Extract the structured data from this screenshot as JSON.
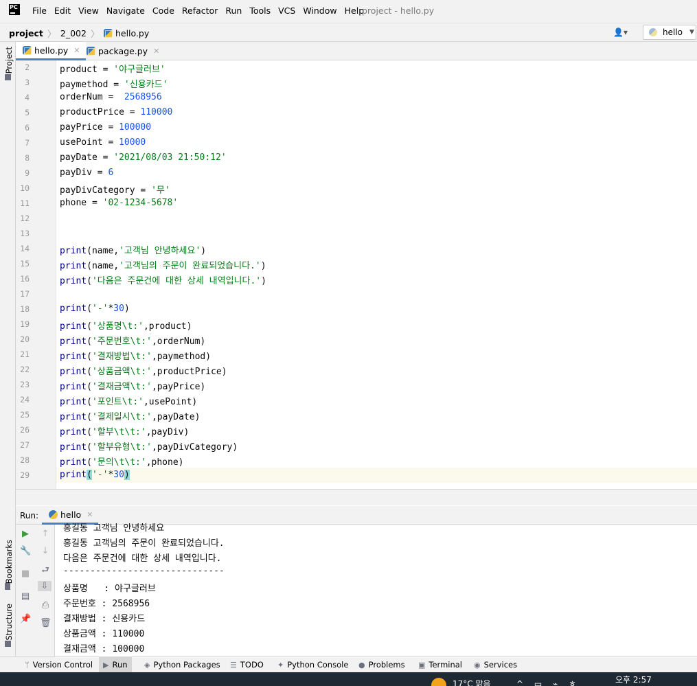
{
  "menubar": {
    "logo": "PC",
    "items": [
      "File",
      "Edit",
      "View",
      "Navigate",
      "Code",
      "Refactor",
      "Run",
      "Tools",
      "VCS",
      "Window",
      "Help"
    ],
    "window_title": "project - hello.py"
  },
  "breadcrumb": {
    "project": "project",
    "folder": "2_002",
    "file": "hello.py",
    "run_config": "hello"
  },
  "sidebar": {
    "project": "Project",
    "bookmarks": "Bookmarks",
    "structure": "Structure"
  },
  "tabs": [
    {
      "label": "hello.py"
    },
    {
      "label": "package.py"
    }
  ],
  "editor": {
    "line_numbers": [
      "2",
      "3",
      "4",
      "5",
      "6",
      "7",
      "8",
      "9",
      "10",
      "11",
      "12",
      "13",
      "14",
      "15",
      "16",
      "17",
      "18",
      "19",
      "20",
      "21",
      "22",
      "23",
      "24",
      "25",
      "26",
      "27",
      "28",
      "29"
    ],
    "lines": [
      "product = '야구글러브'",
      "paymethod = '신용카드'",
      "orderNum =  2568956",
      "productPrice = 110000",
      "payPrice = 100000",
      "usePoint = 10000",
      "payDate = '2021/08/03 21:50:12'",
      "payDiv = 6",
      "payDivCategory = '무'",
      "phone = '02-1234-5678'",
      "",
      "",
      "print(name,'고객님 안녕하세요')",
      "print(name,'고객님의 주문이 완료되었습니다.')",
      "print('다음은 주문건에 대한 상세 내역입니다.')",
      "",
      "print('-'*30)",
      "print('상품명\\t:',product)",
      "print('주문번호\\t:',orderNum)",
      "print('결재방법\\t:',paymethod)",
      "print('상품금액\\t:',productPrice)",
      "print('결재금액\\t:',payPrice)",
      "print('포인트\\t:',usePoint)",
      "print('결제일시\\t:',payDate)",
      "print('할부\\t\\t:',payDiv)",
      "print('할부유형\\t:',payDivCategory)",
      "print('문의\\t\\t:',phone)",
      "print('-'*30)"
    ]
  },
  "run_panel": {
    "label": "Run:",
    "tab": "hello",
    "output": [
      "홍길동 고객님 안녕하세요",
      "홍길동 고객님의 주문이 완료되었습니다.",
      "다음은 주문건에 대한 상세 내역입니다.",
      "------------------------------",
      "상품명   : 야구글러브",
      "주문번호 : 2568956",
      "결재방법 : 신용카드",
      "상품금액 : 110000",
      "결재금액 : 100000"
    ]
  },
  "tool_windows": [
    {
      "label": "Version Control",
      "icon": "version-control-icon"
    },
    {
      "label": "Run",
      "icon": "run-icon"
    },
    {
      "label": "Python Packages",
      "icon": "packages-icon"
    },
    {
      "label": "TODO",
      "icon": "todo-icon"
    },
    {
      "label": "Python Console",
      "icon": "python-console-icon"
    },
    {
      "label": "Problems",
      "icon": "problems-icon"
    },
    {
      "label": "Terminal",
      "icon": "terminal-icon"
    },
    {
      "label": "Services",
      "icon": "services-icon"
    }
  ],
  "taskbar": {
    "weather": "17°C  맑음",
    "clock": "오후 2:57"
  },
  "colors": {
    "keyword": "#000080",
    "string": "#067d17",
    "number": "#1750eb",
    "accent": "#4083c9"
  }
}
